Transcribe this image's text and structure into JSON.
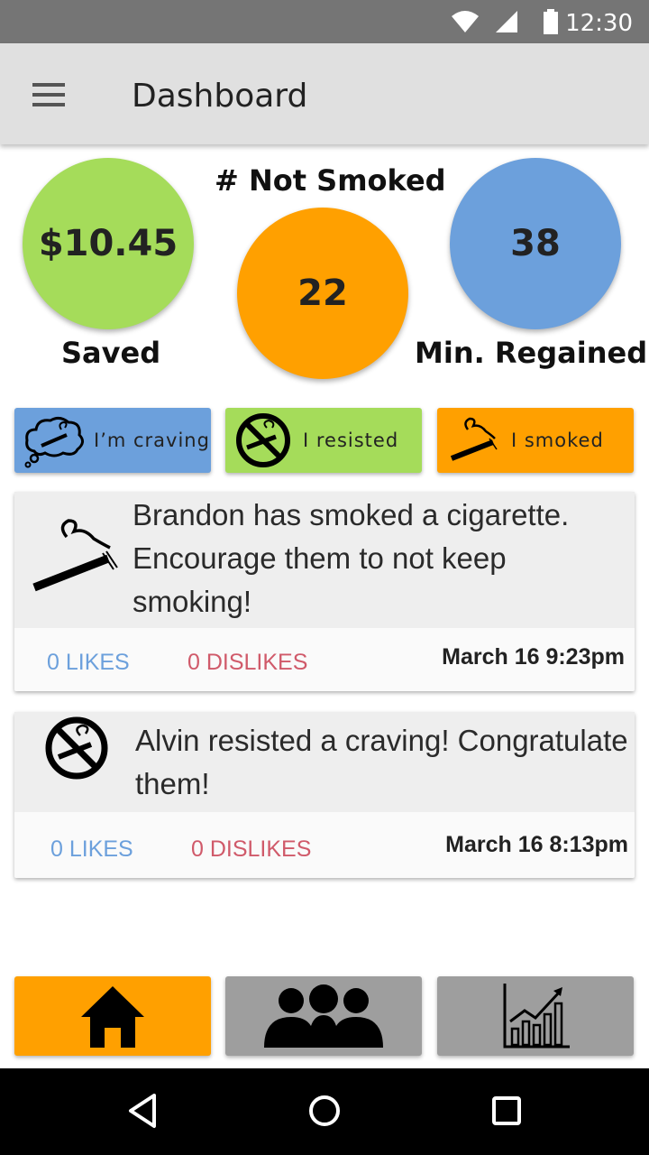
{
  "status_bar": {
    "time": "12:30"
  },
  "app_bar": {
    "title": "Dashboard"
  },
  "stats": {
    "saved_value": "$10.45",
    "saved_label": "Saved",
    "not_smoked_label": "# Not Smoked",
    "not_smoked_value": "22",
    "regained_value": "38",
    "regained_label": "Min. Regained"
  },
  "actions": {
    "craving_label": "I’m craving",
    "resisted_label": "I resisted",
    "smoked_label": "I smoked"
  },
  "feed": [
    {
      "icon": "cigarette-icon",
      "message": "Brandon has smoked a cigarette. Encourage them to not keep smoking!",
      "likes": "0 LIKES",
      "dislikes": "0 DISLIKES",
      "time": "March 16 9:23pm"
    },
    {
      "icon": "no-smoking-icon",
      "message": "Alvin resisted a craving! Congratulate them!",
      "likes": "0 LIKES",
      "dislikes": "0 DISLIKES",
      "time": "March 16 8:13pm"
    }
  ],
  "tabs": {
    "home_icon": "home-icon",
    "community_icon": "group-icon",
    "stats_icon": "chart-icon"
  },
  "colors": {
    "green": "#a5dc5a",
    "orange": "#ffa000",
    "blue": "#6ca0dc",
    "gray_tab": "#9e9e9e",
    "dislike_red": "#d05a6a"
  }
}
